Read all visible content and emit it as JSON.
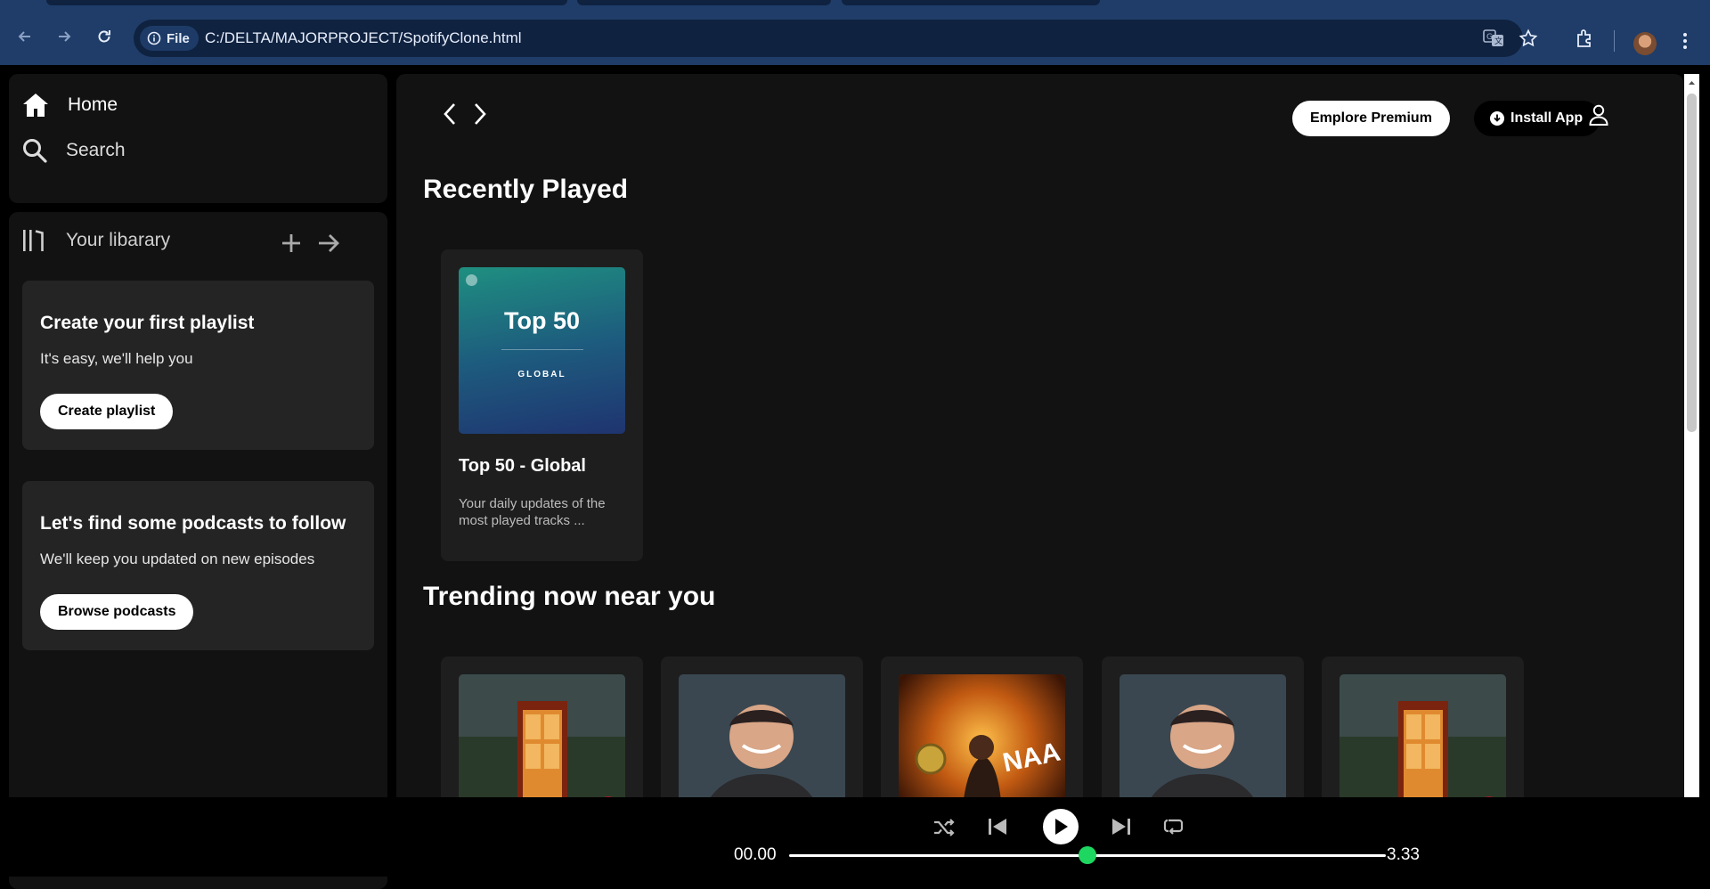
{
  "browser": {
    "url": "C:/DELTA/MAJORPROJECT/SpotifyClone.html",
    "chip_label": "File"
  },
  "nav": {
    "home": "Home",
    "search": "Search"
  },
  "library": {
    "title": "Your libarary",
    "playlist_card": {
      "title": "Create your first playlist",
      "subtitle": "It's easy, we'll help you",
      "button": "Create playlist"
    },
    "podcast_card": {
      "title": "Let's find some podcasts to follow",
      "subtitle": "We'll keep you updated on new episodes",
      "button": "Browse podcasts"
    }
  },
  "header": {
    "premium": "Emplore Premium",
    "install": "Install App"
  },
  "recently_played": {
    "title": "Recently Played",
    "items": [
      {
        "cover_title": "Top 50",
        "cover_subtitle": "GLOBAL",
        "title": "Top 50 - Global",
        "desc": "Your daily updates of the most played tracks ..."
      }
    ]
  },
  "trending": {
    "title": "Trending now near you"
  },
  "player": {
    "current_time": "00.00",
    "total_time": "3.33",
    "progress": 0.5
  },
  "colors": {
    "accent": "#1ed760",
    "panel": "#121212",
    "card": "#242424"
  }
}
